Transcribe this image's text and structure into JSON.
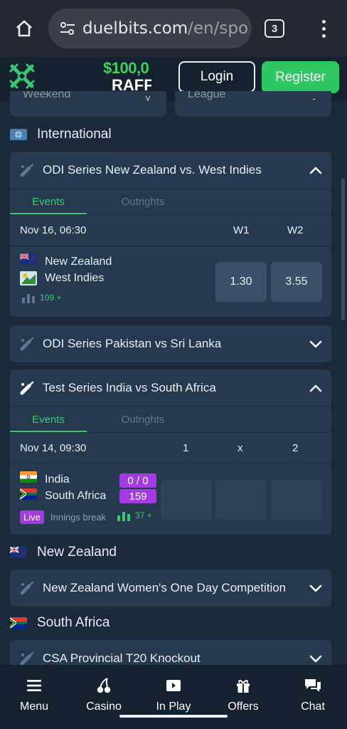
{
  "browser": {
    "url_main": "duelbits.com",
    "url_path": "/en/spo",
    "tab_count": "3"
  },
  "header": {
    "promo_line1": "$100,0",
    "promo_line2": "RAFF",
    "login_label": "Login",
    "register_label": "Register"
  },
  "filters": [
    {
      "label": "Weekend"
    },
    {
      "label": "League"
    }
  ],
  "sections": {
    "international": "International",
    "new_zealand": "New Zealand",
    "south_africa": "South Africa"
  },
  "cards": {
    "odi_nz_wi": {
      "title": "ODI Series New Zealand vs. West Indies",
      "tab_events": "Events",
      "tab_outrights": "Outrights",
      "datetime": "Nov 16, 06:30",
      "col1": "W1",
      "col2": "W2",
      "team1": "New Zealand",
      "team2": "West Indies",
      "markets": "109 +",
      "odd1": "1.30",
      "odd2": "3.55"
    },
    "odi_pak_sl": {
      "title": "ODI Series Pakistan vs Sri Lanka"
    },
    "test_ind_sa": {
      "title": "Test Series India vs South Africa",
      "tab_events": "Events",
      "tab_outrights": "Outrights",
      "datetime": "Nov 14, 09:30",
      "col1": "1",
      "colx": "x",
      "col2": "2",
      "team1": "India",
      "team2": "South Africa",
      "score1": "0 / 0",
      "score2": "159",
      "live_label": "Live",
      "status": "Innings break",
      "markets": "37 +"
    },
    "nz_women": {
      "title": "New Zealand Women's One Day Competition"
    },
    "csa_t20": {
      "title": "CSA Provincial T20 Knockout"
    }
  },
  "bottom_nav": [
    {
      "label": "Menu",
      "icon": "menu-icon"
    },
    {
      "label": "Casino",
      "icon": "cherries-icon"
    },
    {
      "label": "In Play",
      "icon": "play-icon"
    },
    {
      "label": "Offers",
      "icon": "gift-icon"
    },
    {
      "label": "Chat",
      "icon": "chat-icon"
    }
  ],
  "colors": {
    "background": "#1a2a3b",
    "card": "#253a4f",
    "accent_green": "#3cc873",
    "live_purple": "#a33ce0"
  }
}
